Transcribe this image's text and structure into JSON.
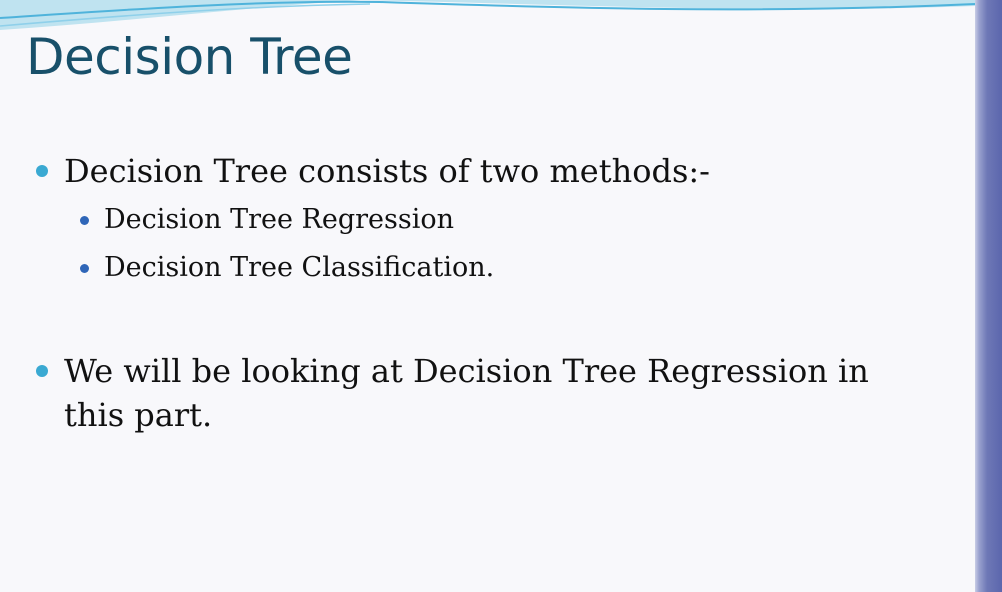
{
  "slide": {
    "title": "Decision Tree",
    "bullets": [
      {
        "text": "Decision Tree consists of two methods:-",
        "sub": [
          "Decision Tree Regression",
          "Decision Tree Classification."
        ]
      },
      {
        "text": "We will be looking at Decision Tree Regression in this part.",
        "sub": []
      }
    ]
  },
  "colors": {
    "title": "#18506a",
    "bullet_level1": "#3aa9d2",
    "bullet_level2": "#2f66b8",
    "right_border": "#5b66ad"
  }
}
